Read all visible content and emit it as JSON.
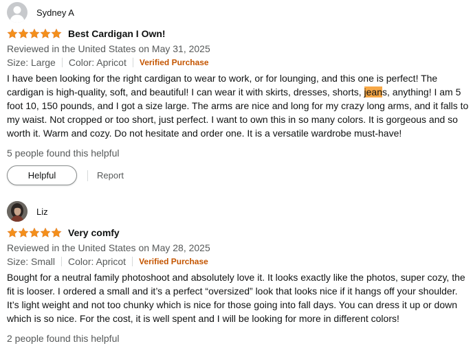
{
  "colors": {
    "star": "#f48f1b",
    "verified": "#c45500",
    "secondary_text": "#565959",
    "highlight": "#f7a847"
  },
  "reviews": [
    {
      "profile_name": "Sydney A",
      "avatar": "default-avatar-icon",
      "rating": 5,
      "title": "Best Cardigan I Own!",
      "date": "Reviewed in the United States on May 31, 2025",
      "size": "Size: Large",
      "color": "Color: Apricot",
      "verified": "Verified Purchase",
      "body_before": "I have been looking for the right cardigan to wear to work, or for lounging, and this one is perfect! The cardigan is high-quality, soft, and beautiful! I can wear it with skirts, dresses, shorts, ",
      "body_highlight": "jean",
      "body_after": "s, anything! I am 5 foot 10, 150 pounds, and I got a size large. The arms are nice and long for my crazy long arms, and it falls to my waist. Not cropped or too short, just perfect. I want to own this in so many colors. It is gorgeous and so worth it. Warm and cozy. Do not hesitate and order one. It is a versatile wardrobe must-have!",
      "helpful_count": "5 people found this helpful",
      "helpful_label": "Helpful",
      "report_label": "Report"
    },
    {
      "profile_name": "Liz",
      "avatar": "user-photo-avatar",
      "rating": 5,
      "title": "Very comfy",
      "date": "Reviewed in the United States on May 28, 2025",
      "size": "Size: Small",
      "color": "Color: Apricot",
      "verified": "Verified Purchase",
      "body": "Bought for a neutral family photoshoot and absolutely love it. It looks exactly like the photos, super cozy, the fit is looser. I ordered a small and it’s a perfect “oversized” look that looks nice if it hangs off your shoulder. It’s light weight and not too chunky which is nice for those going into fall days. You can dress it up or down which is so nice. For the cost, it is well spent and I will be looking for more in different colors!",
      "helpful_count": "2 people found this helpful"
    }
  ]
}
